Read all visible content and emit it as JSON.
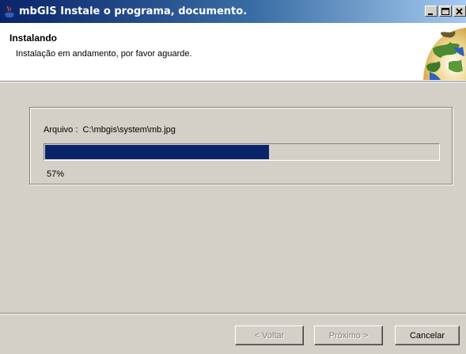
{
  "window": {
    "title": "mbGIS Instale o programa, documento."
  },
  "header": {
    "title": "Instalando",
    "subtitle": "Instalação em andamento, por favor aguarde.",
    "logo_icon": "globe-icon"
  },
  "progress": {
    "file_label": "Arquivo :",
    "file_path": "C:\\mbgis\\system\\mb.jpg",
    "value": 0.57,
    "percent_text": "57%",
    "bar_color": "#0a246a"
  },
  "buttons": {
    "back": "< Voltar",
    "next": "Próximo >",
    "cancel": "Cancelar"
  },
  "title_controls": {
    "minimize_icon": "minimize-icon",
    "maximize_icon": "maximize-icon",
    "close_icon": "close-icon"
  },
  "colors": {
    "title_gradient_start": "#0a246a",
    "title_gradient_end": "#a6caf0",
    "face": "#d4d0c8"
  }
}
